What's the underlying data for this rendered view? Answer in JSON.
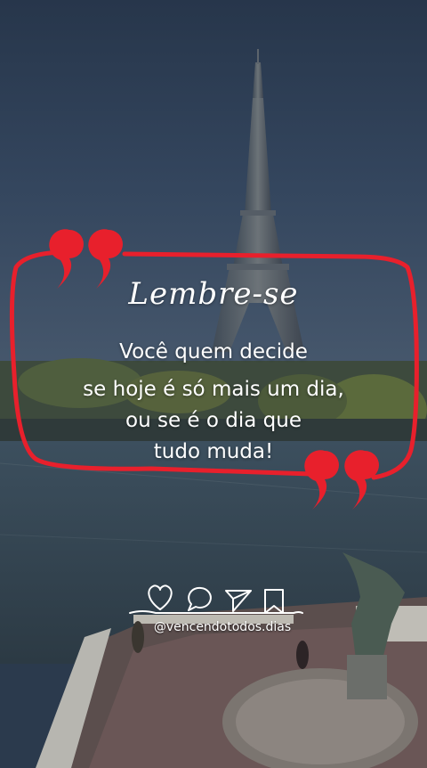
{
  "post": {
    "title": "Lembre-se",
    "quote_lines": [
      "Você quem decide",
      "se hoje é só mais um dia,",
      "ou se é o dia que",
      "tudo muda!"
    ],
    "handle": "@vencendotodos.dias"
  },
  "icons": [
    "heart-icon",
    "comment-icon",
    "share-icon",
    "bookmark-icon",
    "quote-mark-icon"
  ],
  "colors": {
    "accent": "#e8202c",
    "sky_top": "#2a3b52",
    "text": "#ffffff"
  }
}
